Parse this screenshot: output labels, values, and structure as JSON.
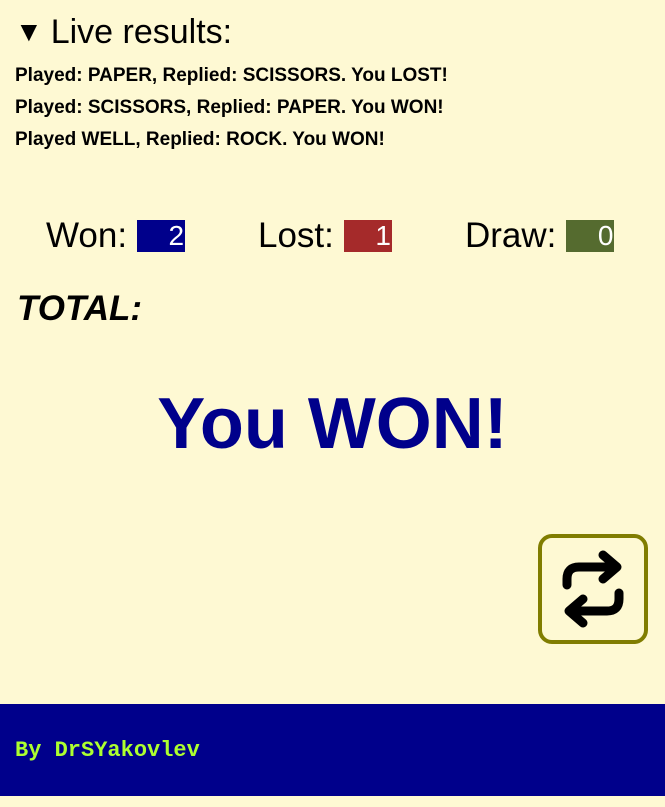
{
  "live_results": {
    "toggle_icon": "triangle-down",
    "title": "Live results:"
  },
  "results": [
    "Played: PAPER, Replied: SCISSORS. You LOST!",
    "Played: SCISSORS, Replied: PAPER. You WON!",
    "Played WELL, Replied: ROCK. You WON!"
  ],
  "score": {
    "won_label": "Won:",
    "won_value": "2",
    "lost_label": "Lost:",
    "lost_value": "1",
    "draw_label": "Draw:",
    "draw_value": "0",
    "won_color": "#00008b",
    "lost_color": "#a52a2a",
    "draw_color": "#556b2f"
  },
  "total": {
    "label": "TOTAL:",
    "verdict": "You WON!"
  },
  "replay": {
    "icon": "repeat-icon",
    "border_color": "#807d00"
  },
  "footer": {
    "text": "By DrSYakovlev",
    "background": "#00008b",
    "text_color": "#adff2f"
  },
  "page_background": "#fef9d3"
}
